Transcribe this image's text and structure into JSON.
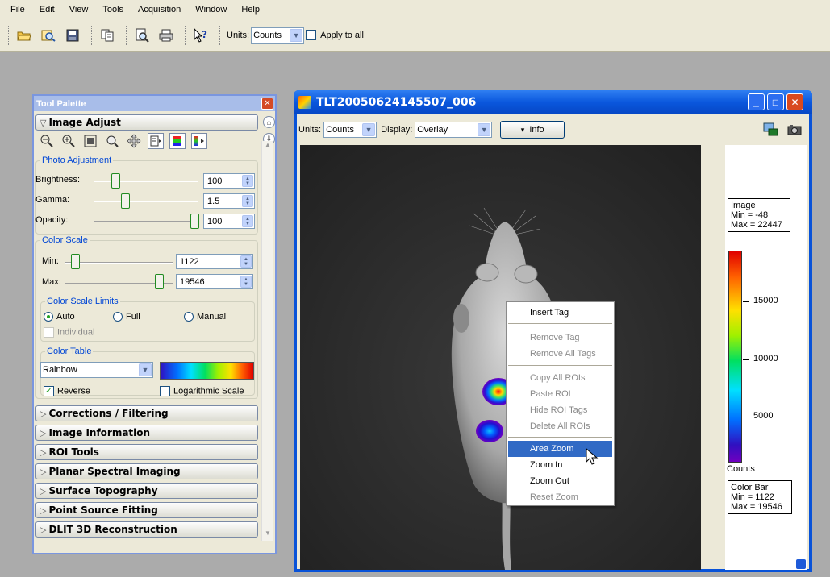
{
  "menu": [
    "File",
    "Edit",
    "View",
    "Tools",
    "Acquisition",
    "Window",
    "Help"
  ],
  "toolbar": {
    "icons": [
      "open-folder-icon",
      "browse-icon",
      "save-icon",
      "copy-icon",
      "print-preview-icon",
      "print-icon",
      "help-pointer-icon"
    ],
    "units_label": "Units:",
    "units_value": "Counts",
    "apply_all_label": "Apply to all",
    "apply_all_checked": false
  },
  "palette": {
    "title": "Tool Palette",
    "image_adjust": "Image Adjust",
    "photo": {
      "label": "Photo Adjustment",
      "brightness_label": "Brightness:",
      "brightness": "100",
      "gamma_label": "Gamma:",
      "gamma": "1.5",
      "opacity_label": "Opacity:",
      "opacity": "100"
    },
    "color_scale": {
      "label": "Color Scale",
      "min_label": "Min:",
      "min": "1122",
      "max_label": "Max:",
      "max": "19546"
    },
    "limits": {
      "label": "Color Scale Limits",
      "auto": "Auto",
      "full": "Full",
      "manual": "Manual",
      "individual": "Individual",
      "selected": "Auto"
    },
    "color_table": {
      "label": "Color Table",
      "value": "Rainbow",
      "reverse": "Reverse",
      "reverse_checked": true,
      "log": "Logarithmic Scale",
      "log_checked": false
    },
    "sections": [
      "Corrections / Filtering",
      "Image Information",
      "ROI Tools",
      "Planar Spectral Imaging",
      "Surface Topography",
      "Point Source Fitting",
      "DLIT 3D Reconstruction"
    ]
  },
  "image_window": {
    "title": "TLT20050624145507_006",
    "units_label": "Units:",
    "units_value": "Counts",
    "display_label": "Display:",
    "display_value": "Overlay",
    "info_button": "Info",
    "image_box": {
      "title": "Image",
      "min": "Min = -48",
      "max": "Max = 22447"
    },
    "colorbar_ticks": [
      "15000",
      "10000",
      "5000"
    ],
    "colorbar_unit": "Counts",
    "colorbar_box": {
      "title": "Color Bar",
      "min": "Min = 1122",
      "max": "Max = 19546"
    }
  },
  "context_menu": [
    {
      "label": "Insert Tag",
      "enabled": true
    },
    {
      "label": "Remove Tag",
      "enabled": false
    },
    {
      "label": "Remove All Tags",
      "enabled": false
    },
    {
      "label": "Copy All ROIs",
      "enabled": false
    },
    {
      "label": "Paste ROI",
      "enabled": false
    },
    {
      "label": "Hide ROI Tags",
      "enabled": false
    },
    {
      "label": "Delete All ROIs",
      "enabled": false
    },
    {
      "label": "Area Zoom",
      "enabled": true,
      "selected": true
    },
    {
      "label": "Zoom In",
      "enabled": true
    },
    {
      "label": "Zoom Out",
      "enabled": true
    },
    {
      "label": "Reset Zoom",
      "enabled": false
    }
  ],
  "colors": {
    "accent": "#0852d8",
    "highlight": "#316ac5",
    "panel": "#ece9d8"
  }
}
